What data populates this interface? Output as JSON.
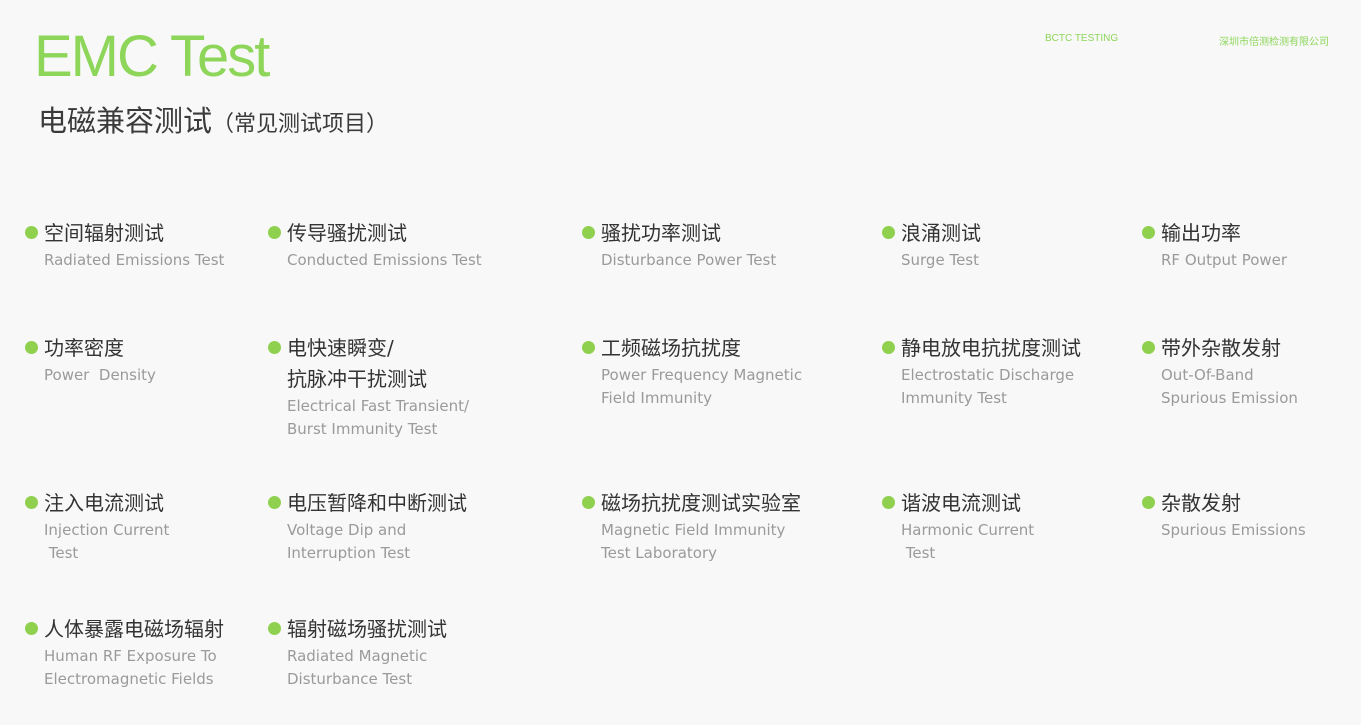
{
  "colors": {
    "accent": "#8dd65a",
    "dot": "#8fd14f",
    "text": "#333333",
    "subtext": "#9a9a9a"
  },
  "header": {
    "title": "EMC Test",
    "subtitle": "电磁兼容测试",
    "subtitle_paren": "（常见测试项目）",
    "brand_left": "BCTC TESTING",
    "brand_right": "深圳市倍测检测有限公司"
  },
  "items": [
    {
      "cn": [
        "空间辐射测试"
      ],
      "en": [
        "Radiated Emissions Test"
      ]
    },
    {
      "cn": [
        "传导骚扰测试"
      ],
      "en": [
        "Conducted Emissions Test"
      ]
    },
    {
      "cn": [
        "骚扰功率测试"
      ],
      "en": [
        "Disturbance Power Test"
      ]
    },
    {
      "cn": [
        "浪涌测试"
      ],
      "en": [
        "Surge Test"
      ]
    },
    {
      "cn": [
        "输出功率"
      ],
      "en": [
        "RF Output Power"
      ]
    },
    {
      "cn": [
        "功率密度"
      ],
      "en": [
        "Power  Density"
      ]
    },
    {
      "cn": [
        "电快速瞬变/",
        "抗脉冲干扰测试"
      ],
      "en": [
        "Electrical Fast Transient/",
        "Burst Immunity Test"
      ]
    },
    {
      "cn": [
        "工频磁场抗扰度"
      ],
      "en": [
        "Power Frequency Magnetic",
        "Field Immunity"
      ]
    },
    {
      "cn": [
        "静电放电抗扰度测试"
      ],
      "en": [
        "Electrostatic Discharge",
        "Immunity Test"
      ]
    },
    {
      "cn": [
        "带外杂散发射"
      ],
      "en": [
        "Out-Of-Band",
        "Spurious Emission"
      ]
    },
    {
      "cn": [
        "注入电流测试"
      ],
      "en": [
        "Injection Current",
        " Test"
      ]
    },
    {
      "cn": [
        "电压暂降和中断测试"
      ],
      "en": [
        "Voltage Dip and",
        "Interruption Test"
      ]
    },
    {
      "cn": [
        "磁场抗扰度测试实验室"
      ],
      "en": [
        "Magnetic Field Immunity",
        "Test Laboratory"
      ]
    },
    {
      "cn": [
        "谐波电流测试"
      ],
      "en": [
        "Harmonic Current",
        " Test"
      ]
    },
    {
      "cn": [
        "杂散发射"
      ],
      "en": [
        "Spurious Emissions"
      ]
    },
    {
      "cn": [
        "人体暴露电磁场辐射"
      ],
      "en": [
        "Human RF Exposure To",
        "Electromagnetic Fields"
      ]
    },
    {
      "cn": [
        "辐射磁场骚扰测试"
      ],
      "en": [
        "Radiated Magnetic",
        "Disturbance Test"
      ]
    }
  ]
}
